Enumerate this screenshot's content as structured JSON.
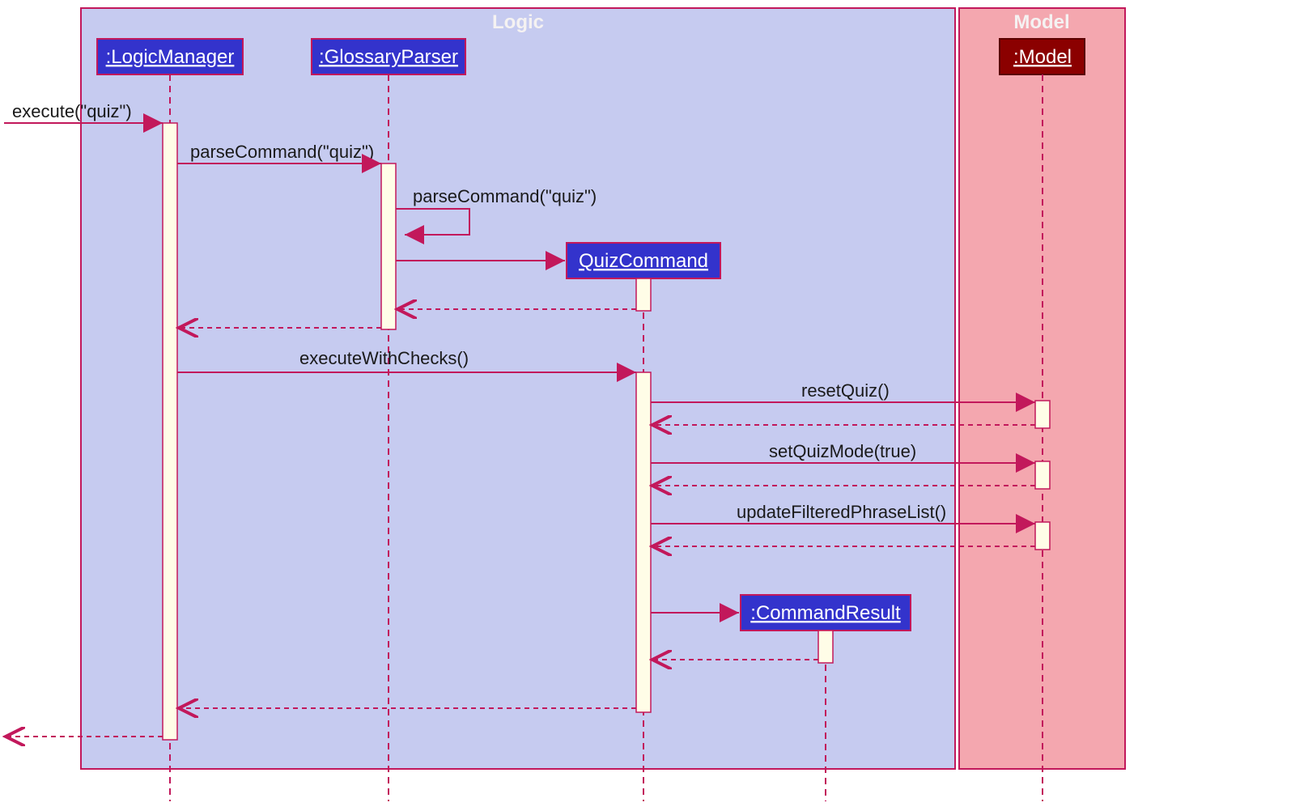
{
  "frames": {
    "logic": {
      "label": "Logic"
    },
    "model": {
      "label": "Model"
    }
  },
  "objects": {
    "logicManager": ":LogicManager",
    "glossaryParser": ":GlossaryParser",
    "quizCommand": "QuizCommand",
    "commandResult": ":CommandResult",
    "model": ":Model"
  },
  "messages": {
    "execute": "execute(\"quiz\")",
    "parseCommand1": "parseCommand(\"quiz\")",
    "parseCommand2": "parseCommand(\"quiz\")",
    "executeWithChecks": "executeWithChecks()",
    "resetQuiz": "resetQuiz()",
    "setQuizMode": "setQuizMode(true)",
    "updateFilteredPhraseList": "updateFilteredPhraseList()"
  }
}
